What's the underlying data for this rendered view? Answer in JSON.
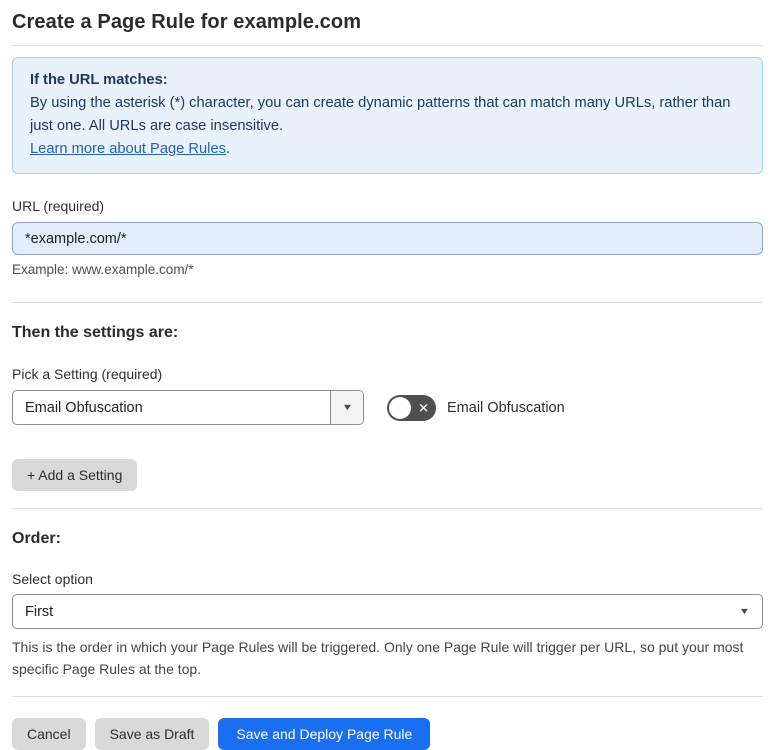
{
  "page": {
    "title": "Create a Page Rule for example.com"
  },
  "info_box": {
    "heading": "If the URL matches:",
    "body": "By using the asterisk (*) character, you can create dynamic patterns that can match many URLs, rather than just one. All URLs are case insensitive.",
    "link_label": "Learn more about Page Rules",
    "link_suffix": "."
  },
  "url_field": {
    "label": "URL (required)",
    "value": "*example.com/*",
    "example": "Example: www.example.com/*"
  },
  "settings_section": {
    "heading": "Then the settings are:",
    "pick_label": "Pick a Setting (required)",
    "selected_setting": "Email Obfuscation",
    "toggle_label": "Email Obfuscation",
    "toggle_state": "off",
    "add_button_label": "+ Add a Setting"
  },
  "order_section": {
    "heading": "Order:",
    "label": "Select option",
    "selected_option": "First",
    "help_text": "This is the order in which your Page Rules will be triggered. Only one Page Rule will trigger per URL, so put your most specific Page Rules at the top."
  },
  "footer": {
    "cancel_label": "Cancel",
    "save_draft_label": "Save as Draft",
    "save_deploy_label": "Save and Deploy Page Rule"
  },
  "icons": {
    "dropdown_arrow": "▼",
    "toggle_off_glyph": "✕"
  },
  "colors": {
    "accent_blue": "#1a6ff0",
    "info_box_bg": "#e9f1fb",
    "info_box_border": "#aacdec",
    "info_text": "#1d3a62",
    "link_blue": "#2463b5",
    "url_input_bg": "#e3ecfa",
    "toggle_track": "#4f4f4f",
    "button_gray": "#d9d9d9"
  }
}
